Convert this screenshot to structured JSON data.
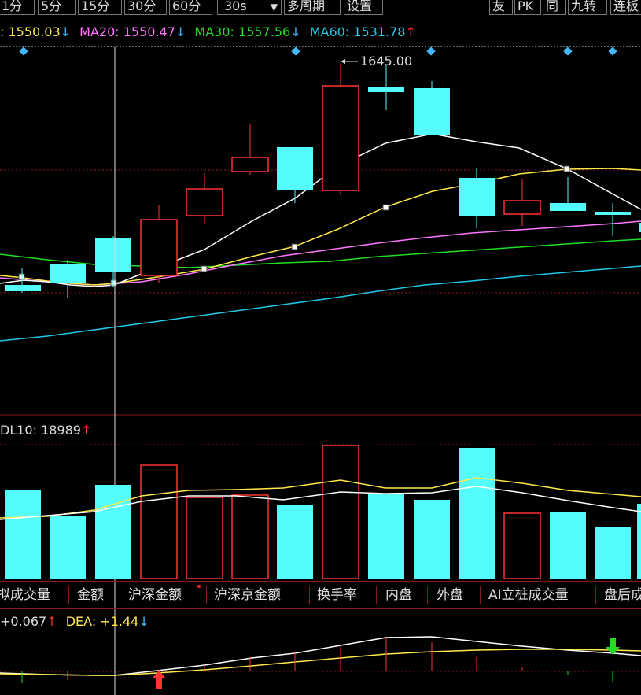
{
  "toolbar": {
    "period_buttons": [
      "1分",
      "5分",
      "15分",
      "30分",
      "60分",
      "30s"
    ],
    "multi_period": "多周期",
    "settings": "设置",
    "right_buttons": [
      "友",
      "PK",
      "同",
      "九转",
      "连板"
    ]
  },
  "ma_legend": [
    {
      "label": ": ",
      "value": "1550.03",
      "arrow": "↓",
      "color": "#ffe84a",
      "arrow_color": "#41b8ff"
    },
    {
      "label": "MA20: ",
      "value": "1550.47",
      "arrow": "↓",
      "color": "#ff77ff",
      "arrow_color": "#41b8ff"
    },
    {
      "label": "MA30: ",
      "value": "1557.56",
      "arrow": "↓",
      "color": "#22dd22",
      "arrow_color": "#41b8ff"
    },
    {
      "label": "MA60: ",
      "value": "1531.78",
      "arrow": "↑",
      "color": "#22c8e8",
      "arrow_color": "#ff3030"
    }
  ],
  "max_label": "1645.00",
  "vol_legend": {
    "label": "DL10: ",
    "value": "18989",
    "arrow": "↑"
  },
  "indicator_tabs": [
    "拟成交量",
    "金额",
    "沪深金额",
    "沪深京金额",
    "换手率",
    "内盘",
    "外盘",
    "AI立桩成交量",
    "盘后成"
  ],
  "macd_legend": {
    "dif_value": "+0.067",
    "dif_arrow": "↑",
    "dea_label": "DEA: ",
    "dea_value": "+1.44",
    "dea_arrow": "↓"
  },
  "colors": {
    "up": "#ff3333",
    "down": "#54fcfc",
    "grid": "#8a1a1a",
    "ma5": "#ffffff",
    "ma10": "#ffe84a",
    "ma20": "#ff77ff",
    "ma30": "#22dd22",
    "ma60": "#22c8e8"
  },
  "chart_data": {
    "type": "candlestick",
    "candles": [
      {
        "dir": "down"
      },
      {
        "dir": "down"
      },
      {
        "dir": "down"
      },
      {
        "dir": "up"
      },
      {
        "dir": "up"
      },
      {
        "dir": "up"
      },
      {
        "dir": "down"
      },
      {
        "dir": "up"
      },
      {
        "dir": "down"
      },
      {
        "dir": "down"
      },
      {
        "dir": "down"
      },
      {
        "dir": "up"
      },
      {
        "dir": "down"
      },
      {
        "dir": "down"
      }
    ],
    "price_high_marker": 1645.0
  }
}
